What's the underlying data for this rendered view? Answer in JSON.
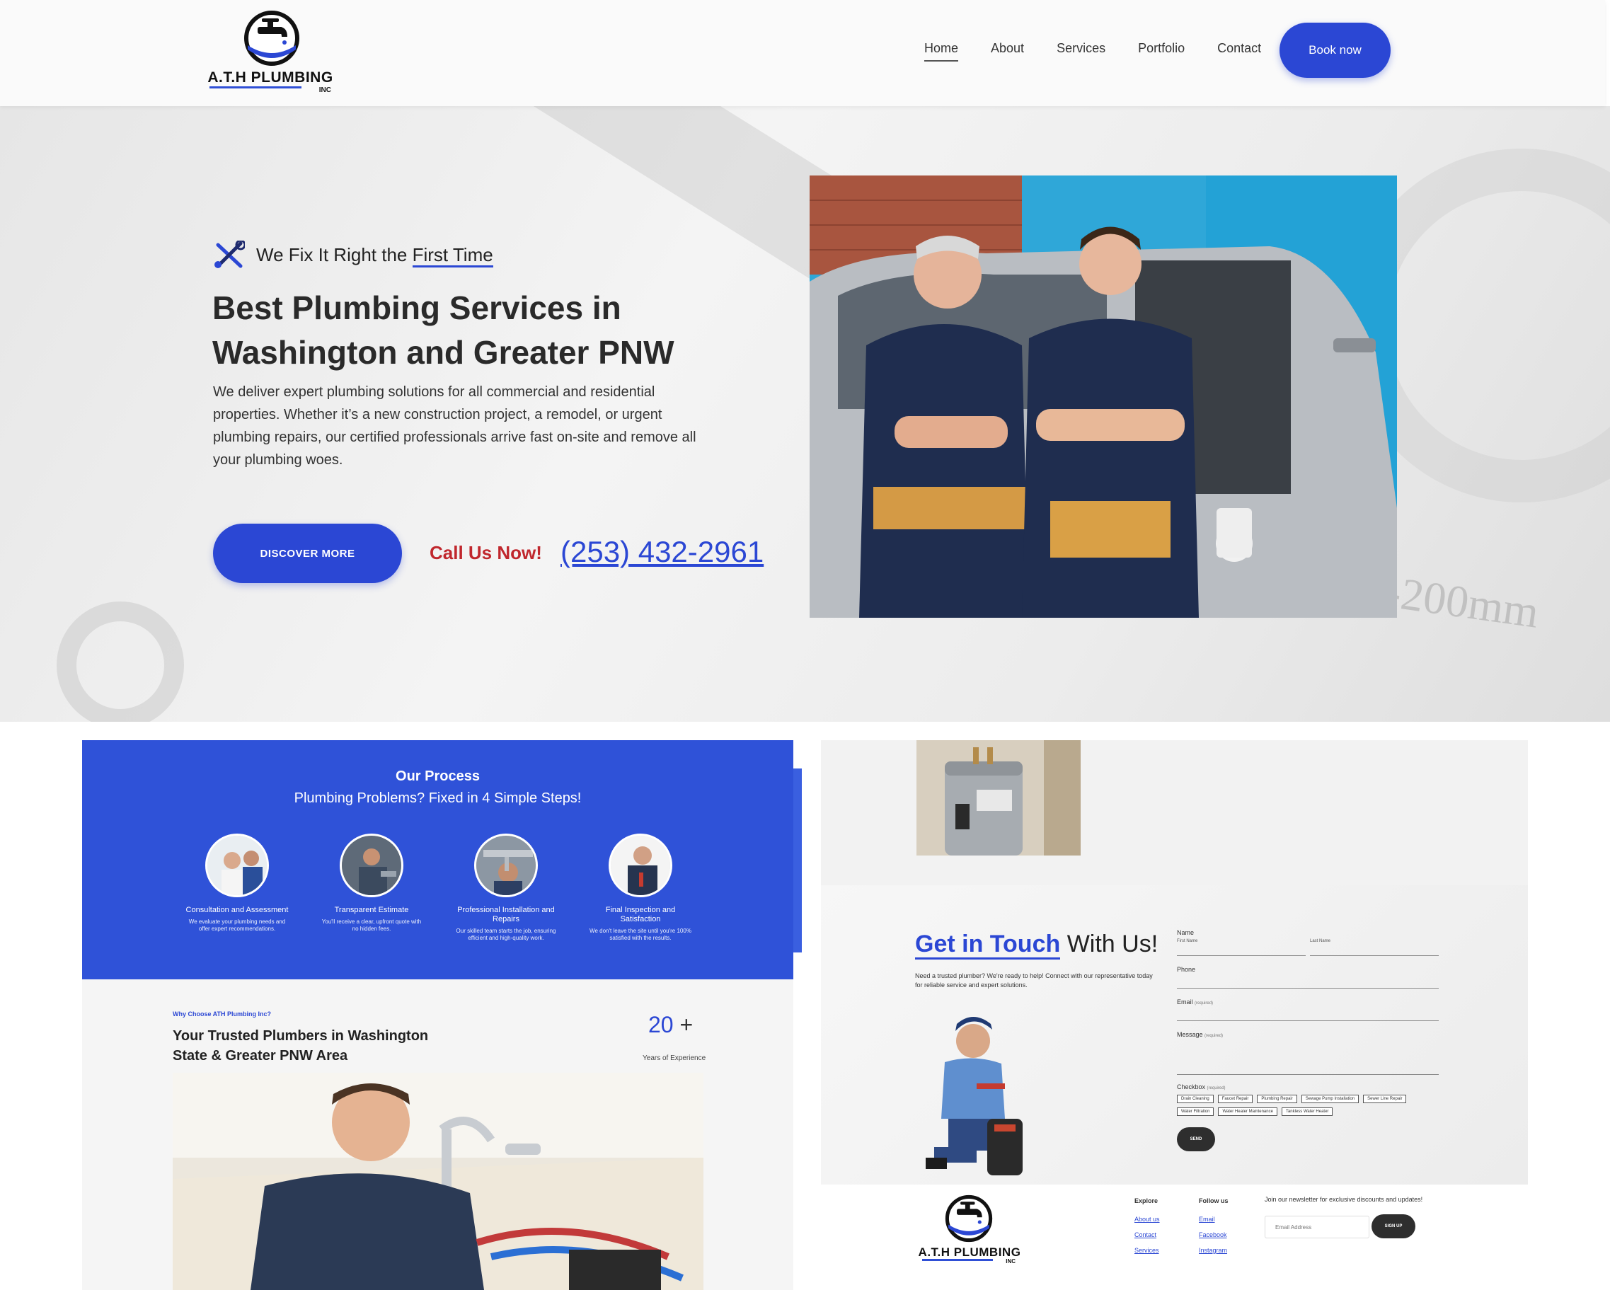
{
  "brand": {
    "name": "A.T.H PLUMBING",
    "suffix": "INC"
  },
  "nav": {
    "items": [
      "Home",
      "About",
      "Services",
      "Portfolio",
      "Contact"
    ],
    "active": "Home",
    "cta": "Book now"
  },
  "hero": {
    "tagline_prefix": "We Fix It Right the ",
    "tagline_highlight": "First Time",
    "title": "Best Plumbing Services in Washington and Greater PNW",
    "description": "We deliver expert plumbing solutions for all commercial and residential properties. Whether it’s a new construction project, a remodel, or urgent plumbing repairs, our certified professionals arrive fast on-site and remove all your plumbing woes.",
    "discover_label": "DISCOVER MORE",
    "call_label": "Call Us Now!",
    "phone": "(253) 432-2961",
    "ruler_text": "3\"-200mm"
  },
  "process": {
    "title": "Our Process",
    "subtitle": "Plumbing Problems? Fixed in 4 Simple Steps!",
    "steps": [
      {
        "title": "Consultation and Assessment",
        "desc": "We evaluate your plumbing needs and offer expert recommendations."
      },
      {
        "title": "Transparent Estimate",
        "desc": "You'll receive a clear, upfront quote with no hidden fees."
      },
      {
        "title": "Professional Installation and Repairs",
        "desc": "Our skilled team starts the job, ensuring efficient and high-quality work."
      },
      {
        "title": "Final Inspection and Satisfaction",
        "desc": "We don't leave the site until you're 100% satisfied with the results."
      }
    ]
  },
  "trusted": {
    "label": "Why Choose ATH Plumbing Inc?",
    "title": "Your Trusted Plumbers in Washington State & Greater PNW Area",
    "years_value": "20",
    "years_plus": "+",
    "years_label": "Years of Experience"
  },
  "contact": {
    "title_blue": "Get in Touch",
    "title_rest": " With Us!",
    "description": "Need a trusted plumber? We're ready to help! Connect with our representative today for reliable service and expert solutions.",
    "form": {
      "name_label": "Name",
      "first_name": "First Name",
      "last_name": "Last Name",
      "phone_label": "Phone",
      "email_label": "Email",
      "message_label": "Message",
      "checkbox_label": "Checkbox",
      "required": "(required)",
      "checkbox_options": [
        "Drain Cleaning",
        "Faucet Repair",
        "Plumbing Repair",
        "Sewage Pump Installation",
        "Sewer Line Repair",
        "Water Filtration",
        "Water Heater Maintenance",
        "Tankless Water Heater"
      ],
      "send_label": "SEND"
    }
  },
  "footer": {
    "explore_title": "Explore",
    "explore_links": [
      "About us",
      "Contact",
      "Services"
    ],
    "follow_title": "Follow us",
    "follow_links": [
      "Email",
      "Facebook",
      "Instagram"
    ],
    "newsletter_text": "Join our newsletter for exclusive discounts and updates!",
    "email_placeholder": "Email Address",
    "signup_label": "SIGN UP"
  },
  "colors": {
    "accent": "#2b47d4",
    "call": "#c0272d",
    "dark": "#2e2e2e"
  }
}
